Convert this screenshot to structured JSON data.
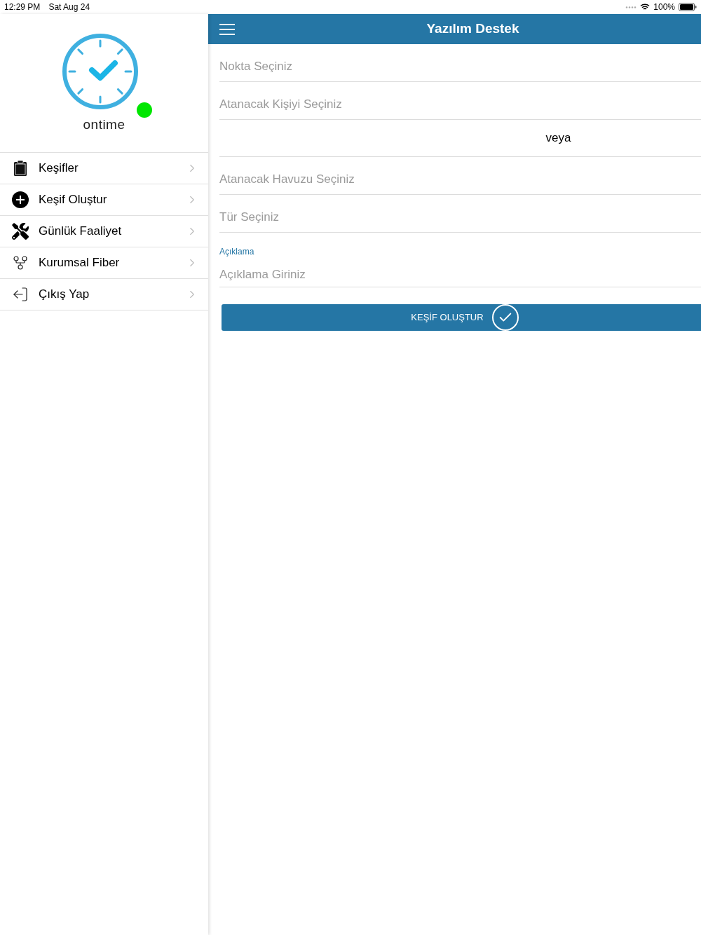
{
  "status_bar": {
    "time": "12:29 PM",
    "date": "Sat Aug 24",
    "battery": "100%"
  },
  "sidebar": {
    "logo_text": "ontime",
    "online": true,
    "items": [
      {
        "label": "Keşifler",
        "kind": "clipboard"
      },
      {
        "label": "Keşif Oluştur",
        "kind": "plus"
      },
      {
        "label": "Günlük Faaliyet",
        "kind": "tools"
      },
      {
        "label": "Kurumsal Fiber",
        "kind": "fork"
      },
      {
        "label": "Çıkış Yap",
        "kind": "logout"
      }
    ]
  },
  "header": {
    "title": "Yazılım Destek"
  },
  "form": {
    "fields": [
      {
        "kind": "select",
        "placeholder": "Nokta Seçiniz"
      },
      {
        "kind": "select",
        "placeholder": "Atanacak Kişiyi Seçiniz"
      },
      {
        "kind": "separator",
        "text": "veya"
      },
      {
        "kind": "select",
        "placeholder": "Atanacak Havuzu Seçiniz"
      },
      {
        "kind": "select",
        "placeholder": "Tür Seçiniz"
      },
      {
        "kind": "input",
        "label": "Açıklama",
        "placeholder": "Açıklama Giriniz"
      }
    ],
    "submit": "KEŞİF OLUŞTUR"
  }
}
